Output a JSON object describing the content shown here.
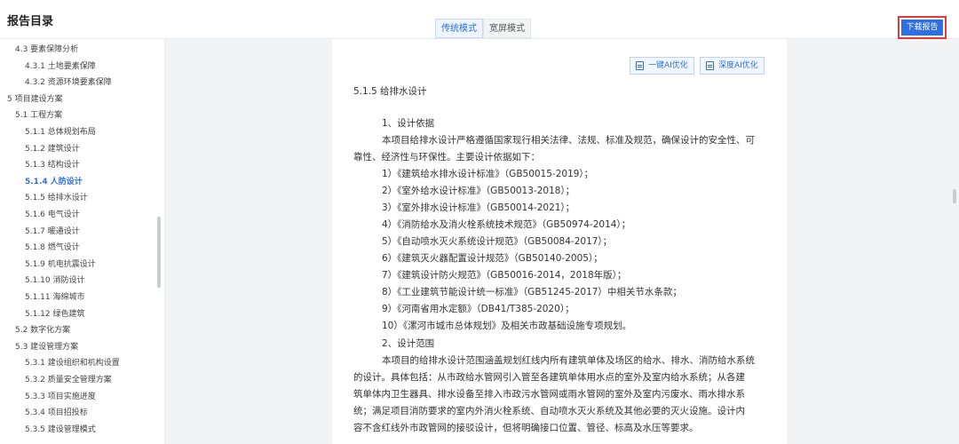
{
  "header": {
    "title": "报告目录",
    "modes": [
      "传统模式",
      "宽屏模式"
    ],
    "download_label": "下载报告"
  },
  "sidebar": {
    "items": [
      {
        "label": "4.3 要素保障分析",
        "level": 2,
        "active": false
      },
      {
        "label": "4.3.1 土地要素保障",
        "level": 3,
        "active": false
      },
      {
        "label": "4.3.2 资源环境要素保障",
        "level": 3,
        "active": false
      },
      {
        "label": "5 项目建设方案",
        "level": 1,
        "active": false
      },
      {
        "label": "5.1 工程方案",
        "level": 2,
        "active": false
      },
      {
        "label": "5.1.1 总体规划布局",
        "level": 3,
        "active": false
      },
      {
        "label": "5.1.2 建筑设计",
        "level": 3,
        "active": false
      },
      {
        "label": "5.1.3 结构设计",
        "level": 3,
        "active": false
      },
      {
        "label": "5.1.4 人防设计",
        "level": 3,
        "active": true
      },
      {
        "label": "5.1.5 给排水设计",
        "level": 3,
        "active": false
      },
      {
        "label": "5.1.6 电气设计",
        "level": 3,
        "active": false
      },
      {
        "label": "5.1.7 暖通设计",
        "level": 3,
        "active": false
      },
      {
        "label": "5.1.8 燃气设计",
        "level": 3,
        "active": false
      },
      {
        "label": "5.1.9 机电抗震设计",
        "level": 3,
        "active": false
      },
      {
        "label": "5.1.10 消防设计",
        "level": 3,
        "active": false
      },
      {
        "label": "5.1.11 海绵城市",
        "level": 3,
        "active": false
      },
      {
        "label": "5.1.12 绿色建筑",
        "level": 3,
        "active": false
      },
      {
        "label": "5.2 数字化方案",
        "level": 2,
        "active": false
      },
      {
        "label": "5.3 建设管理方案",
        "level": 2,
        "active": false
      },
      {
        "label": "5.3.1 建设组织和机构设置",
        "level": 3,
        "active": false
      },
      {
        "label": "5.3.2 质量安全管理方案",
        "level": 3,
        "active": false
      },
      {
        "label": "5.3.3 项目实施进度",
        "level": 3,
        "active": false
      },
      {
        "label": "5.3.4 项目招投标",
        "level": 3,
        "active": false
      },
      {
        "label": "5.3.5 建设管理模式",
        "level": 3,
        "active": false
      }
    ]
  },
  "document": {
    "ai_buttons": [
      "一键AI优化",
      "深度AI优化"
    ],
    "section_title": "5.1.5 给排水设计",
    "lines": [
      "1、设计依据",
      "本项目给排水设计严格遵循国家现行相关法律、法规、标准及规范，确保设计的安全性、可",
      "靠性、经济性与环保性。主要设计依据如下：",
      "1）《建筑给水排水设计标准》（GB50015-2019）；",
      "2）《室外给水设计标准》（GB50013-2018）；",
      "3）《室外排水设计标准》（GB50014-2021）；",
      "4）《消防给水及消火栓系统技术规范》（GB50974-2014）；",
      "5）《自动喷水灭火系统设计规范》（GB50084-2017）；",
      "6）《建筑灭火器配置设计规范》（GB50140-2005）；",
      "7）《建筑设计防火规范》（GB50016-2014，2018年版）；",
      "8）《工业建筑节能设计统一标准》（GB51245-2017）中相关节水条款；",
      "9）《河南省用水定额》（DB41/T385-2020）；",
      "10）《漯河市城市总体规划》及相关市政基础设施专项规划。",
      "2、设计范围",
      "本项目的给排水设计范围涵盖规划红线内所有建筑单体及场区的给水、排水、消防给水系统",
      "的设计。具体包括：从市政给水管网引入管至各建筑单体用水点的室外及室内给水系统；从各建",
      "筑单体内卫生器具、排水设备至排入市政污水管网或雨水管网的室外及室内污废水、雨水排水系",
      "统；满足项目消防要求的室内外消火栓系统、自动喷水灭火系统及其他必要的灭火设施。设计内",
      "容不含红线外市政管网的接驳设计，但将明确接口位置、管径、标高及水压等要求。"
    ]
  }
}
